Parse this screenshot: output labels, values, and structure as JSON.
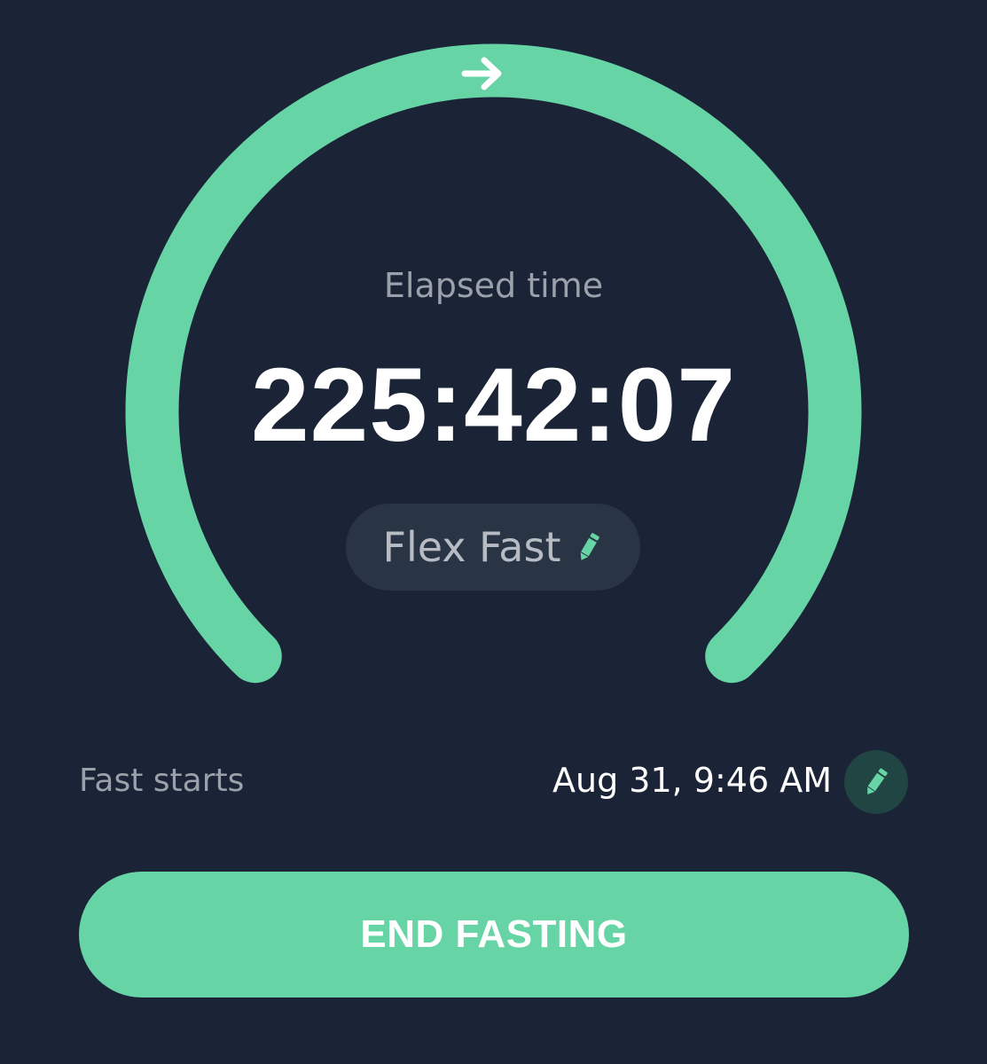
{
  "timer": {
    "elapsed_label": "Elapsed time",
    "elapsed_value": "225:42:07",
    "progress": 1.0
  },
  "plan": {
    "name": "Flex Fast",
    "edit_icon": "pencil-icon"
  },
  "fast_start": {
    "label": "Fast starts",
    "value": "Aug 31, 9:46 AM",
    "edit_icon": "pencil-icon"
  },
  "actions": {
    "end_label": "END FASTING"
  },
  "colors": {
    "background": "#1b2336",
    "accent": "#67d4a6",
    "pill_background": "#293445",
    "edit_circle": "#214543",
    "muted_text": "#9aa1ab",
    "text": "#ffffff"
  }
}
